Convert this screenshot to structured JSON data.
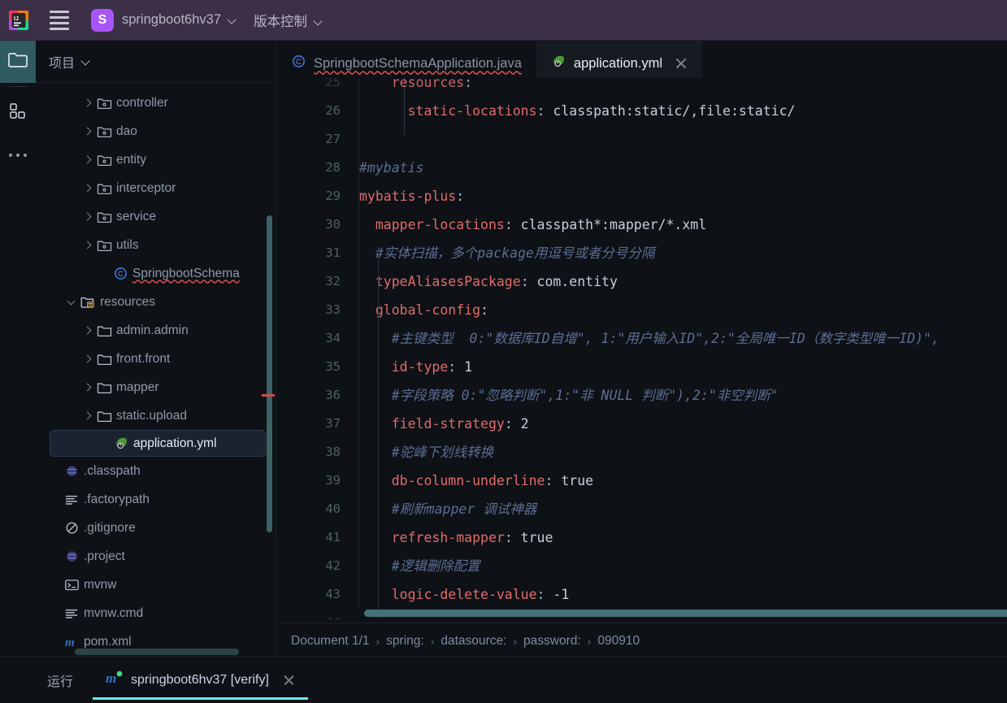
{
  "titlebar": {
    "app_icon": "intellij-idea-logo",
    "menu_icon": "hamburger-menu-icon",
    "avatar_letter": "S",
    "project_name": "springboot6hv37",
    "vcs_label": "版本控制"
  },
  "toolstrip": {
    "items": [
      {
        "name": "project-tool-icon",
        "icon": "folder-icon",
        "active": true
      },
      {
        "name": "structure-tool-icon",
        "icon": "grid-blocks-icon",
        "active": false
      },
      {
        "name": "more-tools-icon",
        "icon": "ellipsis-icon",
        "active": false
      }
    ]
  },
  "project_panel": {
    "header_label": "项目",
    "tree": [
      {
        "label": "controller",
        "indent": 3,
        "arrow": "right",
        "icon": "package-folder-icon",
        "selected": false
      },
      {
        "label": "dao",
        "indent": 3,
        "arrow": "right",
        "icon": "package-folder-icon",
        "selected": false
      },
      {
        "label": "entity",
        "indent": 3,
        "arrow": "right",
        "icon": "package-folder-icon",
        "selected": false
      },
      {
        "label": "interceptor",
        "indent": 3,
        "arrow": "right",
        "icon": "package-folder-icon",
        "selected": false
      },
      {
        "label": "service",
        "indent": 3,
        "arrow": "right",
        "icon": "package-folder-icon",
        "selected": false
      },
      {
        "label": "utils",
        "indent": 3,
        "arrow": "right",
        "icon": "package-folder-icon",
        "selected": false
      },
      {
        "label": "SpringbootSchema",
        "indent": 4,
        "arrow": "none",
        "icon": "java-class-icon",
        "selected": false
      },
      {
        "label": "resources",
        "indent": 2,
        "arrow": "down",
        "icon": "resources-folder-icon",
        "selected": false
      },
      {
        "label": "admin.admin",
        "indent": 3,
        "arrow": "right",
        "icon": "folder-icon",
        "selected": false
      },
      {
        "label": "front.front",
        "indent": 3,
        "arrow": "right",
        "icon": "folder-icon",
        "selected": false
      },
      {
        "label": "mapper",
        "indent": 3,
        "arrow": "right",
        "icon": "folder-icon",
        "selected": false
      },
      {
        "label": "static.upload",
        "indent": 3,
        "arrow": "right",
        "icon": "folder-icon",
        "selected": false
      },
      {
        "label": "application.yml",
        "indent": 4,
        "arrow": "none",
        "icon": "spring-yml-icon",
        "selected": true
      },
      {
        "label": ".classpath",
        "indent": 1,
        "arrow": "none",
        "icon": "eclipse-file-icon",
        "selected": false
      },
      {
        "label": ".factorypath",
        "indent": 1,
        "arrow": "none",
        "icon": "text-file-icon",
        "selected": false
      },
      {
        "label": ".gitignore",
        "indent": 1,
        "arrow": "none",
        "icon": "gitignore-icon",
        "selected": false
      },
      {
        "label": ".project",
        "indent": 1,
        "arrow": "none",
        "icon": "eclipse-file-icon",
        "selected": false
      },
      {
        "label": "mvnw",
        "indent": 1,
        "arrow": "none",
        "icon": "shell-script-icon",
        "selected": false
      },
      {
        "label": "mvnw.cmd",
        "indent": 1,
        "arrow": "none",
        "icon": "text-file-icon",
        "selected": false
      },
      {
        "label": "pom.xml",
        "indent": 1,
        "arrow": "none",
        "icon": "maven-icon",
        "selected": false
      }
    ]
  },
  "tabs": [
    {
      "label": "SpringbootSchemaApplication.java",
      "icon": "java-class-icon",
      "active": false,
      "closable": false,
      "error": true
    },
    {
      "label": "application.yml",
      "icon": "spring-yml-icon",
      "active": true,
      "closable": true,
      "error": false
    }
  ],
  "editor": {
    "first_visible_line": 25,
    "lines": [
      {
        "no": "25",
        "partial": true,
        "tokens": [
          {
            "t": "    resources",
            "c": "k"
          },
          {
            "t": ":",
            "c": "colon"
          }
        ]
      },
      {
        "no": "26",
        "partial": false,
        "tokens": [
          {
            "t": "      static-locations",
            "c": "k"
          },
          {
            "t": ":",
            "c": "colon"
          },
          {
            "t": " classpath:static/,file:static/",
            "c": "v"
          }
        ]
      },
      {
        "no": "27",
        "partial": false,
        "tokens": []
      },
      {
        "no": "28",
        "partial": false,
        "tokens": [
          {
            "t": "#mybatis",
            "c": "c"
          }
        ]
      },
      {
        "no": "29",
        "partial": false,
        "tokens": [
          {
            "t": "mybatis-plus",
            "c": "k"
          },
          {
            "t": ":",
            "c": "colon"
          }
        ]
      },
      {
        "no": "30",
        "partial": false,
        "tokens": [
          {
            "t": "  mapper-locations",
            "c": "k"
          },
          {
            "t": ":",
            "c": "colon"
          },
          {
            "t": " classpath*:mapper/*.xml",
            "c": "v"
          }
        ]
      },
      {
        "no": "31",
        "partial": false,
        "tokens": [
          {
            "t": "  #实体扫描，多个package用逗号或者分号分隔",
            "c": "c"
          }
        ]
      },
      {
        "no": "32",
        "partial": false,
        "tokens": [
          {
            "t": "  typeAliasesPackage",
            "c": "k"
          },
          {
            "t": ":",
            "c": "colon"
          },
          {
            "t": " com.entity",
            "c": "v"
          }
        ]
      },
      {
        "no": "33",
        "partial": false,
        "tokens": [
          {
            "t": "  global-config",
            "c": "k"
          },
          {
            "t": ":",
            "c": "colon"
          }
        ]
      },
      {
        "no": "34",
        "partial": false,
        "tokens": [
          {
            "t": "    #主键类型  0:\"数据库ID自增\", 1:\"用户输入ID\",2:\"全局唯一ID（数字类型唯一ID)\",",
            "c": "c"
          }
        ]
      },
      {
        "no": "35",
        "partial": false,
        "tokens": [
          {
            "t": "    id-type",
            "c": "k"
          },
          {
            "t": ":",
            "c": "colon"
          },
          {
            "t": " 1",
            "c": "n"
          }
        ]
      },
      {
        "no": "36",
        "partial": false,
        "tokens": [
          {
            "t": "    #字段策略 0:\"忽略判断\",1:\"非 NULL 判断\"),2:\"非空判断\"",
            "c": "c"
          }
        ]
      },
      {
        "no": "37",
        "partial": false,
        "tokens": [
          {
            "t": "    field-strategy",
            "c": "k"
          },
          {
            "t": ":",
            "c": "colon"
          },
          {
            "t": " 2",
            "c": "n"
          }
        ]
      },
      {
        "no": "38",
        "partial": false,
        "tokens": [
          {
            "t": "    #驼峰下划线转换",
            "c": "c"
          }
        ]
      },
      {
        "no": "39",
        "partial": false,
        "tokens": [
          {
            "t": "    db-column-underline",
            "c": "k"
          },
          {
            "t": ":",
            "c": "colon"
          },
          {
            "t": " true",
            "c": "v"
          }
        ]
      },
      {
        "no": "40",
        "partial": false,
        "tokens": [
          {
            "t": "    #刷新mapper 调试神器",
            "c": "c"
          }
        ]
      },
      {
        "no": "41",
        "partial": false,
        "tokens": [
          {
            "t": "    refresh-mapper",
            "c": "k"
          },
          {
            "t": ":",
            "c": "colon"
          },
          {
            "t": " true",
            "c": "v"
          }
        ]
      },
      {
        "no": "42",
        "partial": false,
        "tokens": [
          {
            "t": "    #逻辑删除配置",
            "c": "c"
          }
        ]
      },
      {
        "no": "43",
        "partial": false,
        "tokens": [
          {
            "t": "    logic-delete-value",
            "c": "k"
          },
          {
            "t": ":",
            "c": "colon"
          },
          {
            "t": " -1",
            "c": "n"
          }
        ]
      },
      {
        "no": "44",
        "partial": true,
        "tokens": []
      }
    ]
  },
  "breadcrumb": {
    "items": [
      "Document 1/1",
      "spring:",
      "datasource:",
      "password:",
      "090910"
    ],
    "separator": "›"
  },
  "run_panel": {
    "title": "运行",
    "tab_label": "springboot6hv37 [verify]",
    "tab_icon": "maven-icon",
    "close_icon": "close-icon"
  },
  "colors": {
    "titlebar_bg": "#3b3048",
    "editor_bg": "#0e1116",
    "accent_cyan": "#5ff0ff",
    "selected_tool_bg": "#2f5a5e",
    "scrollbar_teal": "#447277",
    "key_red": "#e06c6c",
    "comment_blue": "#5c6e94",
    "avatar_purple": "#a855f7"
  }
}
